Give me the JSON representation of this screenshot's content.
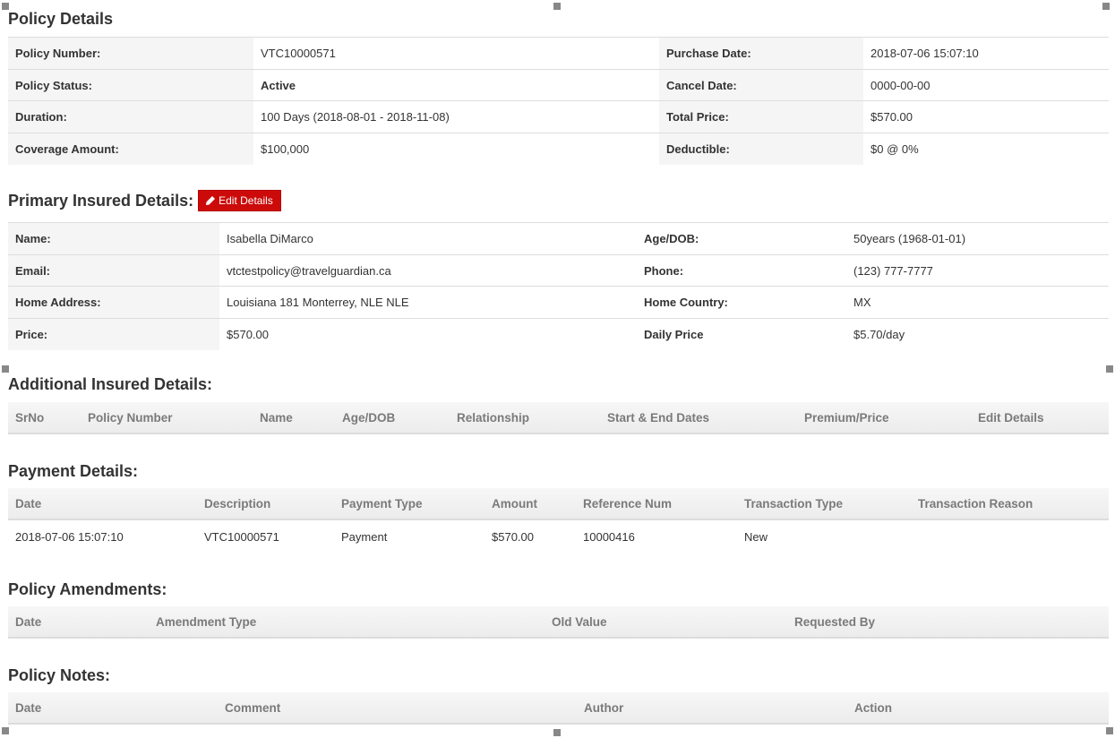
{
  "policy_details": {
    "title": "Policy Details",
    "rows": [
      {
        "label1": "Policy Number:",
        "value1": "VTC10000571",
        "label2": "Purchase Date:",
        "value2": "2018-07-06 15:07:10"
      },
      {
        "label1": "Policy Status:",
        "value1": "Active",
        "label2": "Cancel Date:",
        "value2": "0000-00-00"
      },
      {
        "label1": "Duration:",
        "value1": "100 Days (2018-08-01 - 2018-11-08)",
        "label2": "Total Price:",
        "value2": "$570.00"
      },
      {
        "label1": "Coverage Amount:",
        "value1": "$100,000",
        "label2": "Deductible:",
        "value2": "$0 @ 0%"
      }
    ]
  },
  "primary_insured": {
    "title": "Primary Insured Details:",
    "edit_button": "Edit Details",
    "rows": [
      {
        "label1": "Name:",
        "value1": "Isabella DiMarco",
        "label2": "Age/DOB:",
        "value2": "50years (1968-01-01)"
      },
      {
        "label1": "Email:",
        "value1": "vtctestpolicy@travelguardian.ca",
        "label2": "Phone:",
        "value2": "(123) 777-7777"
      },
      {
        "label1": "Home Address:",
        "value1": "Louisiana 181 Monterrey, NLE NLE",
        "label2": "Home Country:",
        "value2": "MX"
      },
      {
        "label1": "Price:",
        "value1": "$570.00",
        "label2": "Daily Price",
        "value2": "$5.70/day"
      }
    ]
  },
  "additional_insured": {
    "title": "Additional Insured Details:",
    "columns": [
      "SrNo",
      "Policy Number",
      "Name",
      "Age/DOB",
      "Relationship",
      "Start & End Dates",
      "Premium/Price",
      "Edit Details"
    ]
  },
  "payment_details": {
    "title": "Payment Details:",
    "columns": [
      "Date",
      "Description",
      "Payment Type",
      "Amount",
      "Reference Num",
      "Transaction Type",
      "Transaction Reason"
    ],
    "rows": [
      [
        "2018-07-06 15:07:10",
        "VTC10000571",
        "Payment",
        "$570.00",
        "10000416",
        "New",
        ""
      ]
    ]
  },
  "policy_amendments": {
    "title": "Policy Amendments:",
    "columns": [
      "Date",
      "Amendment Type",
      "Old Value",
      "Requested By"
    ]
  },
  "policy_notes": {
    "title": "Policy Notes:",
    "columns": [
      "Date",
      "Comment",
      "Author",
      "Action"
    ]
  },
  "colors": {
    "accent_red": "#cc0a0a",
    "cancel_date_text": "#a01818",
    "label_bg": "#f5f5f5"
  },
  "icons": {
    "edit": "pencil-icon",
    "selection": "resize-handle"
  }
}
